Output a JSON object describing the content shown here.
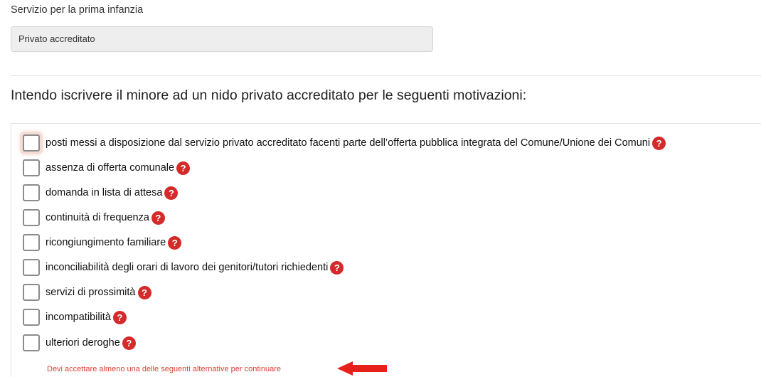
{
  "service": {
    "label": "Servizio per la prima infanzia",
    "value": "Privato accreditato"
  },
  "motivations": {
    "title": "Intendo iscrivere il minore ad un nido privato accreditato per le seguenti motivazioni:",
    "options": [
      {
        "label": "posti messi a disposizione dal servizio privato accreditato facenti parte dell’offerta pubblica integrata del Comune/Unione dei Comuni",
        "checked": false,
        "help_icon": "question-icon"
      },
      {
        "label": "assenza di offerta comunale",
        "checked": false,
        "help_icon": "question-icon"
      },
      {
        "label": "domanda in lista di attesa",
        "checked": false,
        "help_icon": "question-icon"
      },
      {
        "label": "continuità di frequenza",
        "checked": false,
        "help_icon": "question-icon"
      },
      {
        "label": "ricongiungimento familiare",
        "checked": false,
        "help_icon": "question-icon"
      },
      {
        "label": "inconciliabilità degli orari di lavoro dei genitori/tutori richiedenti",
        "checked": false,
        "help_icon": "question-icon"
      },
      {
        "label": "servizi di prossimità",
        "checked": false,
        "help_icon": "question-icon"
      },
      {
        "label": "incompatibilità",
        "checked": false,
        "help_icon": "question-icon"
      },
      {
        "label": "ulteriori deroghe",
        "checked": false,
        "help_icon": "question-icon"
      }
    ],
    "help_symbol": "?",
    "error": "Devi accettare almeno una delle seguenti alternative per continuare"
  },
  "colors": {
    "help_icon": "#d42a2a",
    "error_text": "#d9413a",
    "arrow": "#e8201c",
    "input_background": "#eeeeee"
  }
}
